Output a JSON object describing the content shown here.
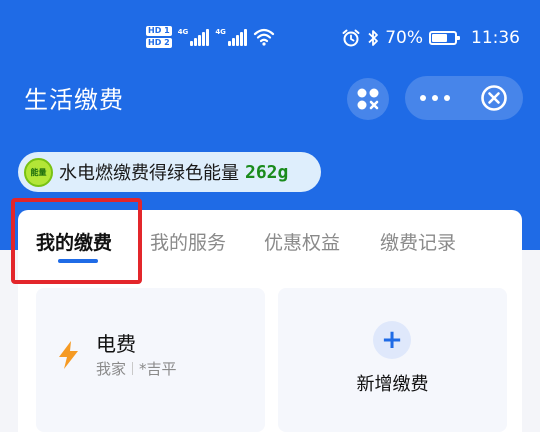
{
  "status_bar": {
    "hd1": "HD 1",
    "hd2": "HD 2",
    "net1": "4G",
    "net2": "4G",
    "battery": "70%",
    "time": "11:36",
    "battery_level": 0.7
  },
  "nav": {
    "title": "生活缴费",
    "scan_icon": "scan-icon",
    "more_icon": "more-dots-icon",
    "close_icon": "close-circle-icon"
  },
  "energy": {
    "badge": "能量",
    "text": "水电燃缴费得绿色能量",
    "value": "262g"
  },
  "tabs": [
    {
      "label": "我的缴费",
      "active": true
    },
    {
      "label": "我的服务",
      "active": false
    },
    {
      "label": "优惠权益",
      "active": false
    },
    {
      "label": "缴费记录",
      "active": false
    }
  ],
  "tiles": {
    "electricity": {
      "title": "电费",
      "home": "我家",
      "name": "*吉平",
      "icon": "lightning-icon"
    },
    "add": {
      "label": "新增缴费",
      "icon": "plus-icon"
    }
  },
  "colors": {
    "brand": "#1f6be6",
    "highlight": "#e3262b",
    "energy_green": "#1a8b1c",
    "bolt": "#f59a23"
  }
}
